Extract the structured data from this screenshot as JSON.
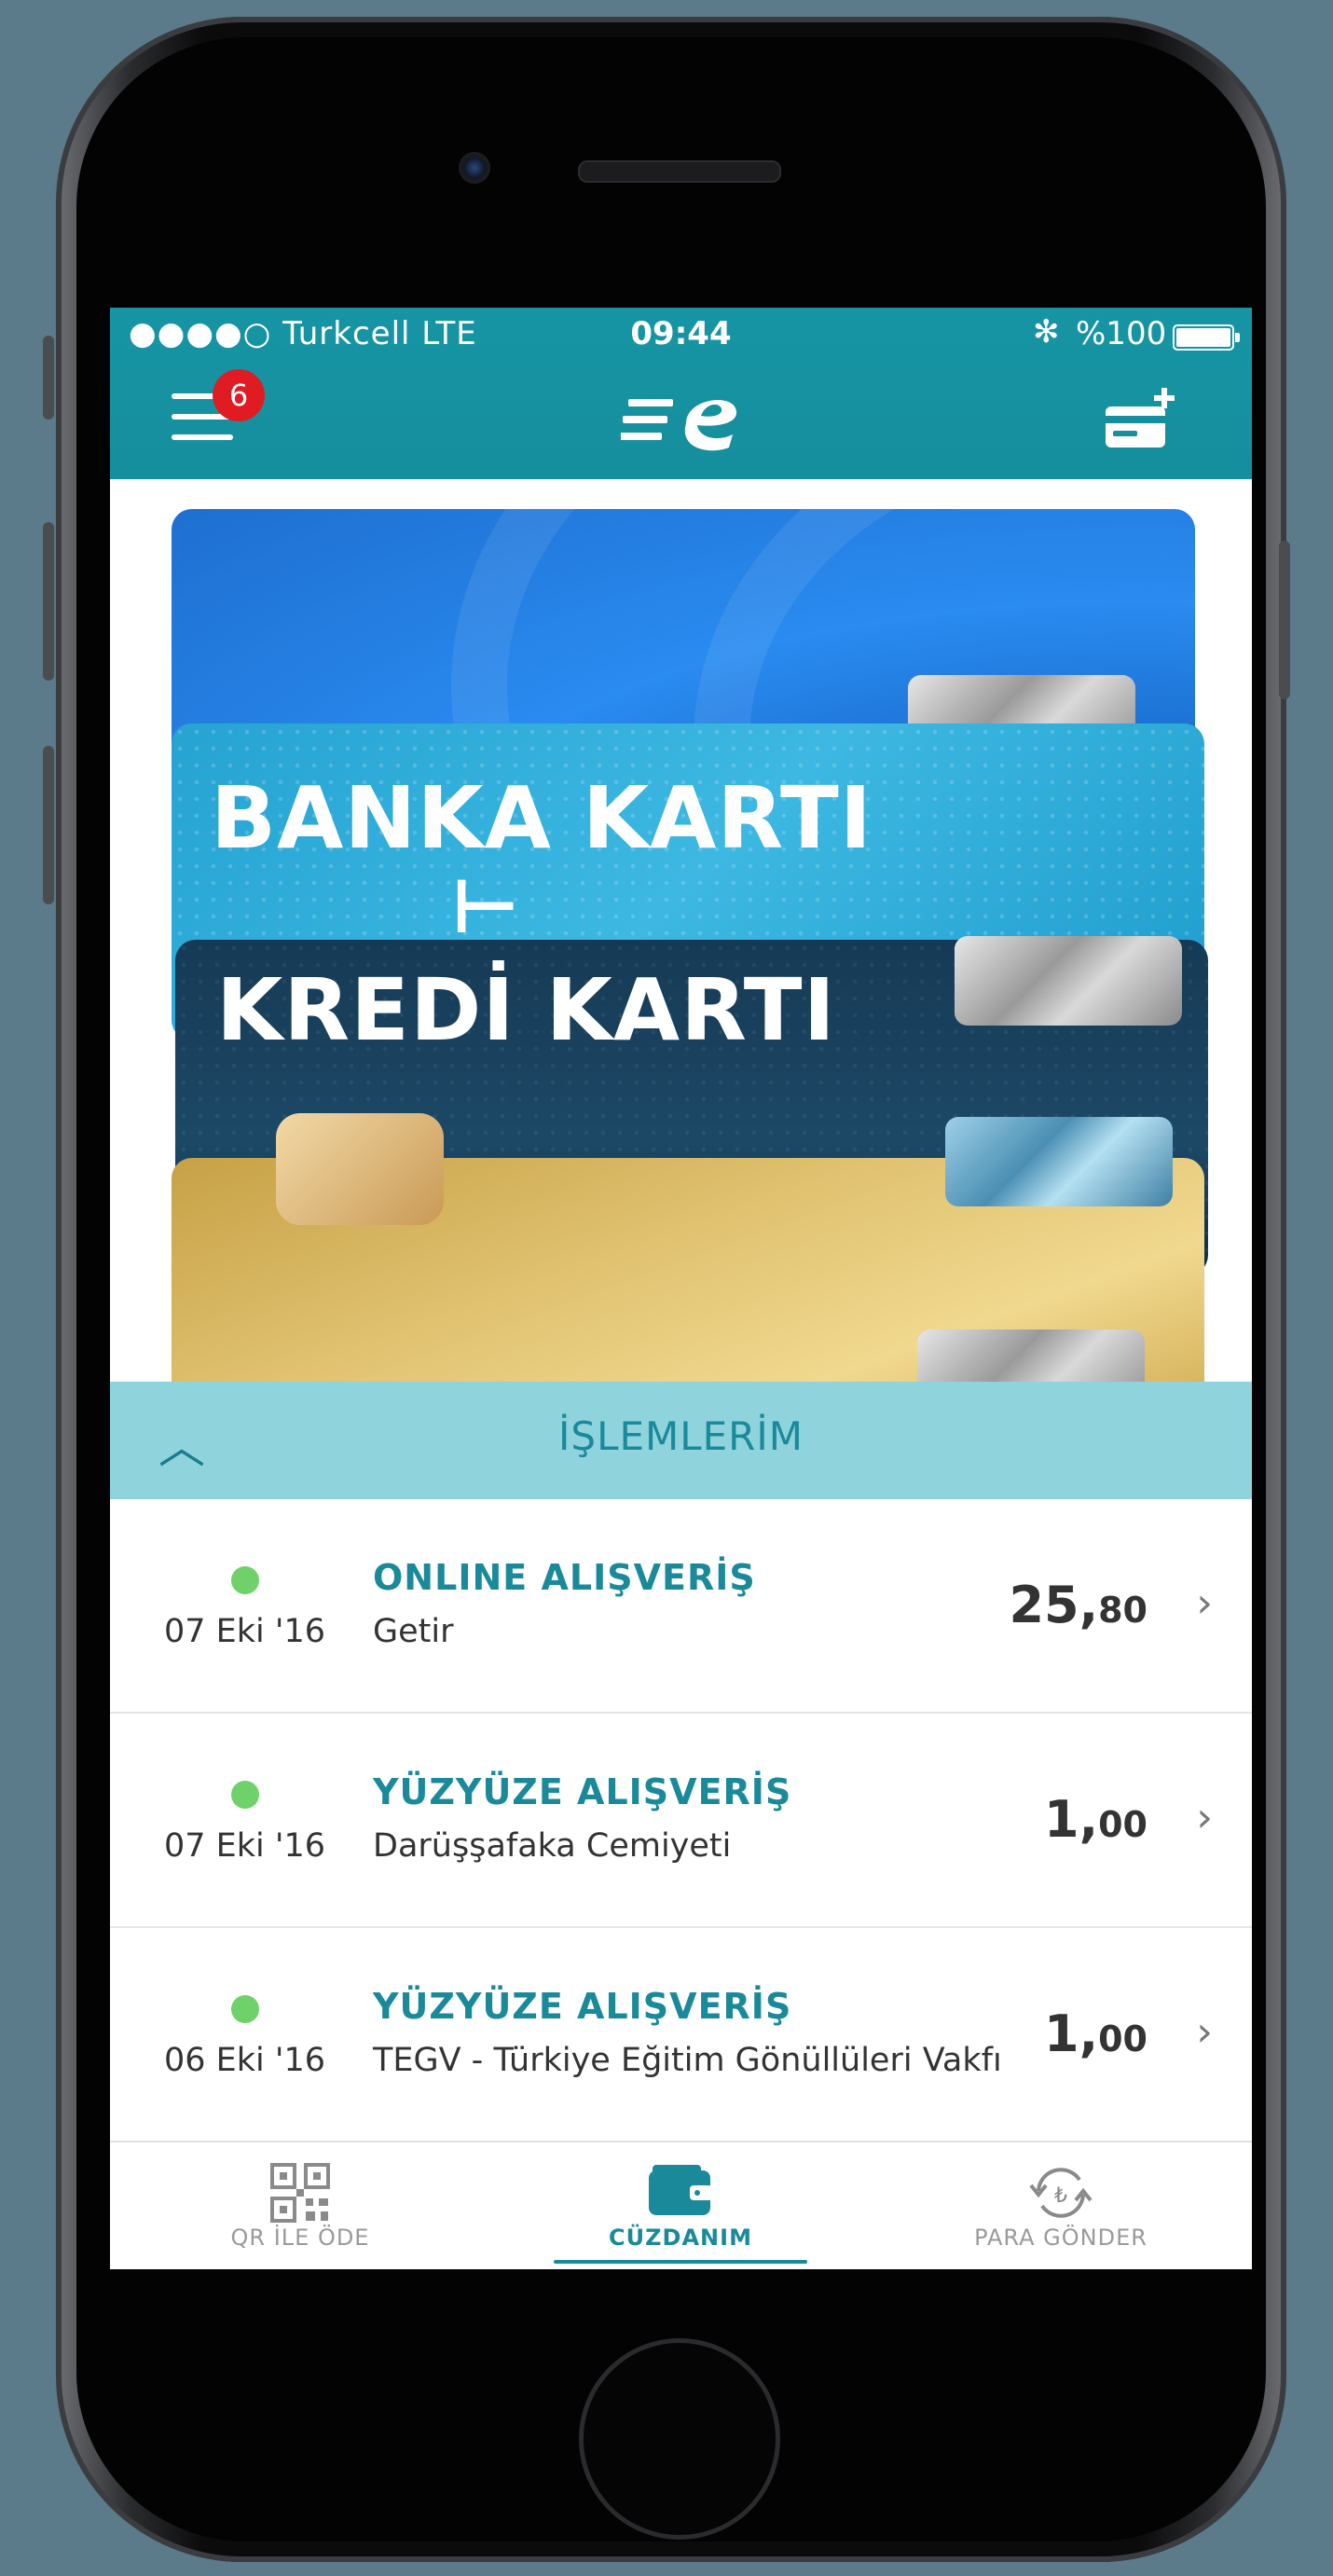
{
  "status_bar": {
    "carrier": "●●●●○ Turkcell   LTE",
    "time": "09:44",
    "bluetooth": "✻",
    "battery": "%100"
  },
  "header": {
    "notification_count": "6"
  },
  "cards": {
    "debit_title": "BANKA KARTI",
    "credit_title": "KREDİ KARTI"
  },
  "transactions_section": {
    "title": "İŞLEMLERİM",
    "items": [
      {
        "date": "07 Eki '16",
        "type": "ONLINE ALIŞVERİŞ",
        "merchant": "Getir",
        "amount_int": "25,",
        "amount_dec": "80"
      },
      {
        "date": "07 Eki '16",
        "type": "YÜZYÜZE ALIŞVERİŞ",
        "merchant": "Darüşşafaka Cemiyeti",
        "amount_int": "1,",
        "amount_dec": "00"
      },
      {
        "date": "06 Eki '16",
        "type": "YÜZYÜZE ALIŞVERİŞ",
        "merchant": "TEGV - Türkiye Eğitim Gönüllüleri Vakfı",
        "amount_int": "1,",
        "amount_dec": "00"
      }
    ]
  },
  "tabbar": {
    "qr": "QR İLE ÖDE",
    "wallet": "CÜZDANIM",
    "send": "PARA GÖNDER"
  },
  "colors": {
    "accent": "#1795a4",
    "section": "#8fd3dd",
    "status_dot": "#6fd16a",
    "badge": "#e01b22"
  }
}
